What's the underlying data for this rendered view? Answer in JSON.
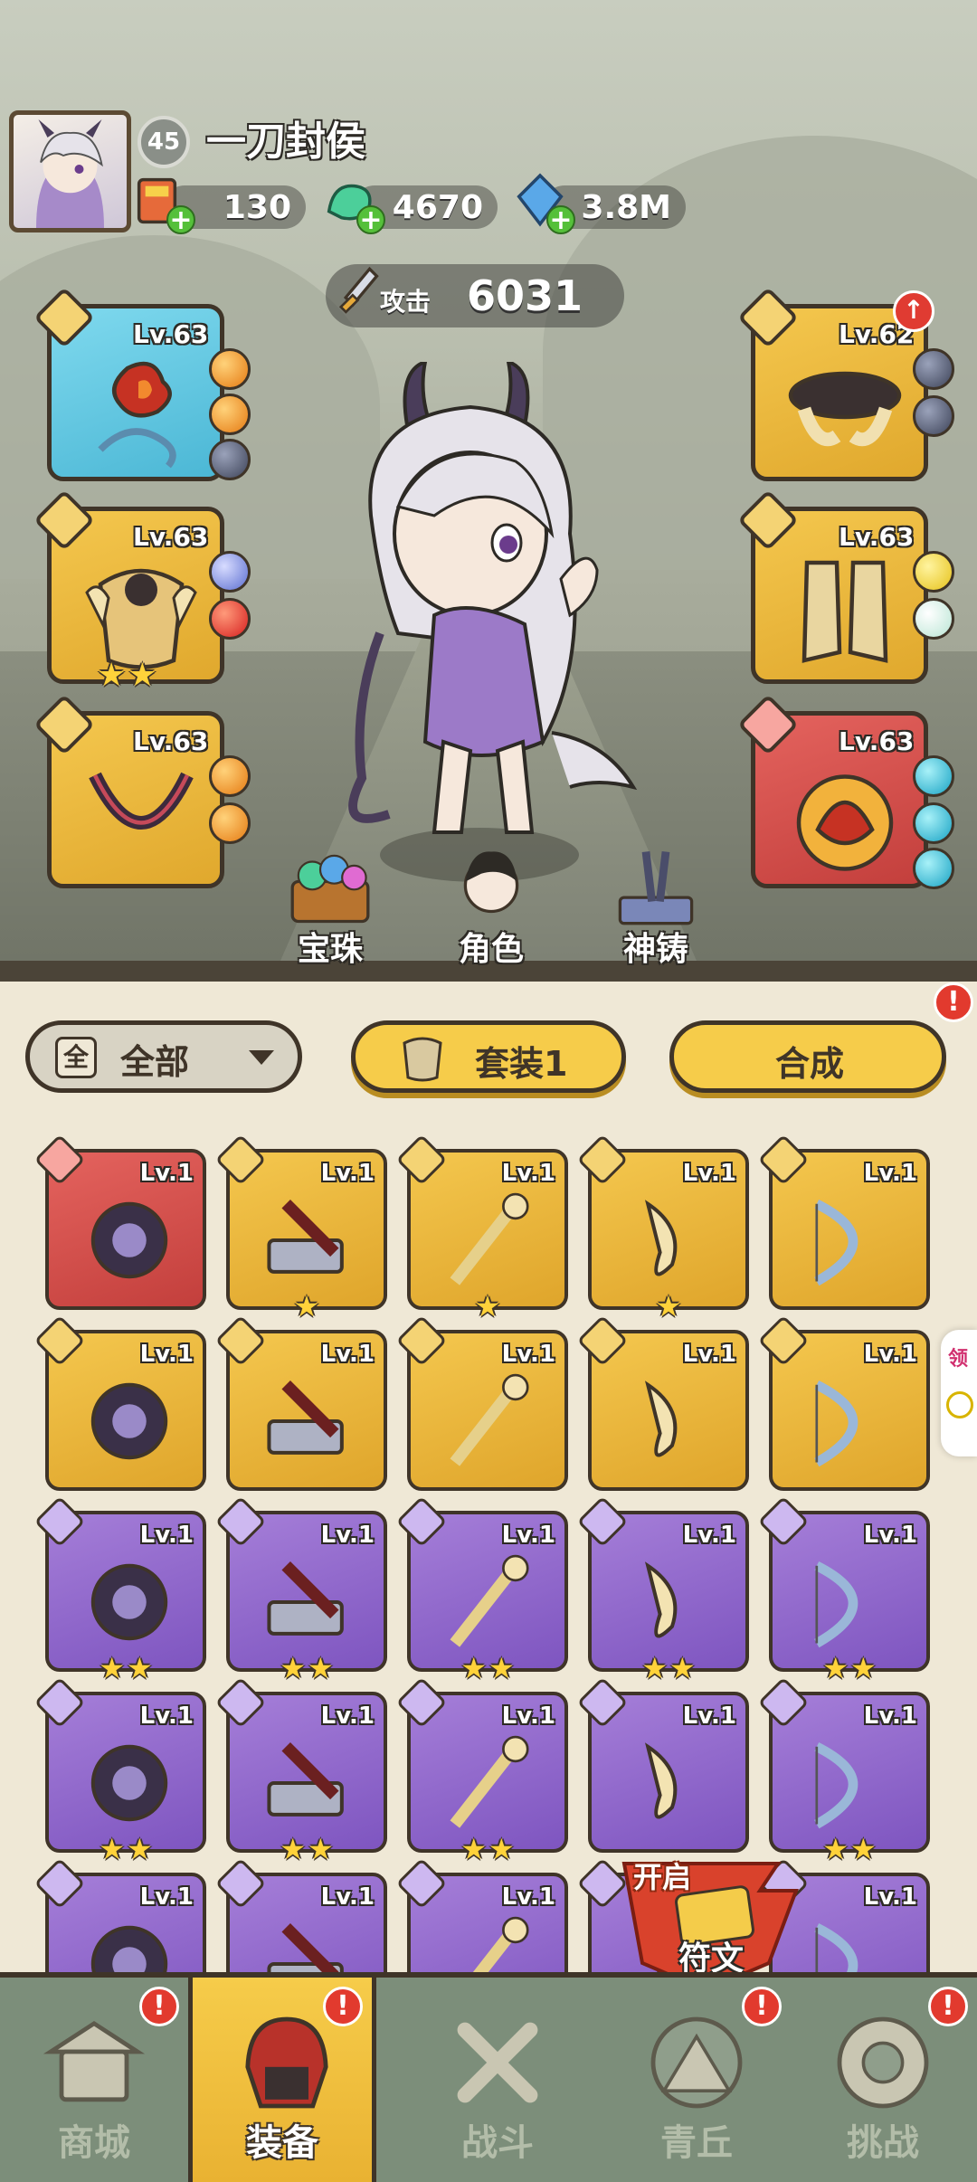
{
  "player": {
    "level": "45",
    "name": "一刀封侯"
  },
  "resources": [
    {
      "name": "ticket",
      "value": "130",
      "icon": "coupon-icon"
    },
    {
      "name": "jade",
      "value": "4670",
      "icon": "jade-dragon-icon"
    },
    {
      "name": "crystal",
      "value": "3.8M",
      "icon": "crystal-icon"
    }
  ],
  "attack": {
    "label": "攻击",
    "value": "6031"
  },
  "equipped": {
    "left": [
      {
        "lv": "Lv.63",
        "rarity": "blue",
        "item": "crimson-flower-whip"
      },
      {
        "lv": "Lv.63",
        "rarity": "gold",
        "item": "gold-armor",
        "stars": 2
      },
      {
        "lv": "Lv.63",
        "rarity": "gold",
        "item": "dark-necklace"
      }
    ],
    "right": [
      {
        "lv": "Lv.62",
        "rarity": "gold",
        "item": "horn-belt"
      },
      {
        "lv": "Lv.63",
        "rarity": "gold",
        "item": "gold-boots"
      },
      {
        "lv": "Lv.63",
        "rarity": "red",
        "item": "lotus-ornament"
      }
    ]
  },
  "quick": [
    {
      "label": "宝珠"
    },
    {
      "label": "角色"
    },
    {
      "label": "神铸"
    }
  ],
  "filter": {
    "icon_text": "全",
    "label": "全部"
  },
  "suit_button": {
    "label": "套装1"
  },
  "craft_button": {
    "label": "合成"
  },
  "inventory": [
    {
      "lv": "Lv.1",
      "rarity": "red",
      "stars": 0
    },
    {
      "lv": "Lv.1",
      "rarity": "gold",
      "stars": 1
    },
    {
      "lv": "Lv.1",
      "rarity": "gold",
      "stars": 1
    },
    {
      "lv": "Lv.1",
      "rarity": "gold",
      "stars": 1
    },
    {
      "lv": "Lv.1",
      "rarity": "gold",
      "stars": 0
    },
    {
      "lv": "Lv.1",
      "rarity": "gold",
      "stars": 0
    },
    {
      "lv": "Lv.1",
      "rarity": "gold",
      "stars": 0
    },
    {
      "lv": "Lv.1",
      "rarity": "gold",
      "stars": 0
    },
    {
      "lv": "Lv.1",
      "rarity": "gold",
      "stars": 0
    },
    {
      "lv": "Lv.1",
      "rarity": "gold",
      "stars": 0
    },
    {
      "lv": "Lv.1",
      "rarity": "purple",
      "stars": 2
    },
    {
      "lv": "Lv.1",
      "rarity": "purple",
      "stars": 2
    },
    {
      "lv": "Lv.1",
      "rarity": "purple",
      "stars": 2
    },
    {
      "lv": "Lv.1",
      "rarity": "purple",
      "stars": 2
    },
    {
      "lv": "Lv.1",
      "rarity": "purple",
      "stars": 2
    },
    {
      "lv": "Lv.1",
      "rarity": "purple",
      "stars": 2
    },
    {
      "lv": "Lv.1",
      "rarity": "purple",
      "stars": 2
    },
    {
      "lv": "Lv.1",
      "rarity": "purple",
      "stars": 2
    },
    {
      "lv": "Lv.1",
      "rarity": "purple",
      "stars": 0
    },
    {
      "lv": "Lv.1",
      "rarity": "purple",
      "stars": 2
    },
    {
      "lv": "Lv.1",
      "rarity": "purple",
      "stars": 0
    },
    {
      "lv": "Lv.1",
      "rarity": "purple",
      "stars": 0
    },
    {
      "lv": "Lv.1",
      "rarity": "purple",
      "stars": 0
    },
    {
      "lv": "Lv.1",
      "rarity": "purple",
      "stars": 0
    },
    {
      "lv": "Lv.1",
      "rarity": "purple",
      "stars": 0
    }
  ],
  "rune": {
    "open_label": "开启",
    "label": "符文"
  },
  "side_tab": {
    "label": "领"
  },
  "alert_glyph": "!",
  "nav": [
    {
      "label": "商城",
      "icon": "shop-icon"
    },
    {
      "label": "装备",
      "icon": "helmet-icon",
      "active": true
    },
    {
      "label": "战斗",
      "icon": "crossed-swords-icon"
    },
    {
      "label": "青丘",
      "icon": "mountain-icon"
    },
    {
      "label": "挑战",
      "icon": "challenge-icon"
    }
  ],
  "colors": {
    "gold": "#f4c74e",
    "purple": "#a57ed8",
    "red": "#e4635e",
    "blue": "#7fd9ee",
    "alert": "#e23a2e"
  }
}
